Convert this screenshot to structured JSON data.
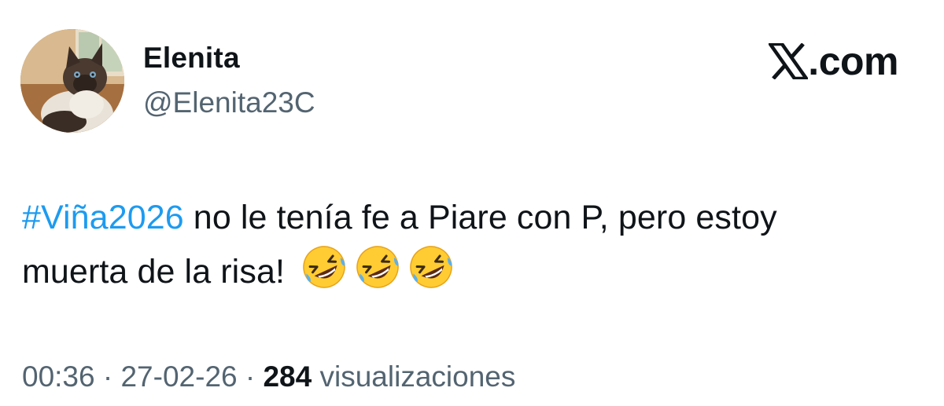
{
  "author": {
    "display_name": "Elenita",
    "handle": "@Elenita23C",
    "avatar_icon": "cat-avatar"
  },
  "brand": {
    "logo_icon": "x-logo-icon",
    "label": ".com"
  },
  "tweet": {
    "hashtag": "#Viña2026",
    "text_part1": " no le tenía fe a Piare con P, pero estoy",
    "text_part2": "muerta de la risa!",
    "emojis": [
      "rolling-on-floor-laughing",
      "rolling-on-floor-laughing",
      "rolling-on-floor-laughing"
    ]
  },
  "meta": {
    "time": "00:36",
    "separator": "·",
    "date": "27-02-26",
    "views_count": "284",
    "views_label": "visualizaciones"
  },
  "colors": {
    "text": "#0f1419",
    "secondary": "#536471",
    "link": "#1d9bf0"
  }
}
